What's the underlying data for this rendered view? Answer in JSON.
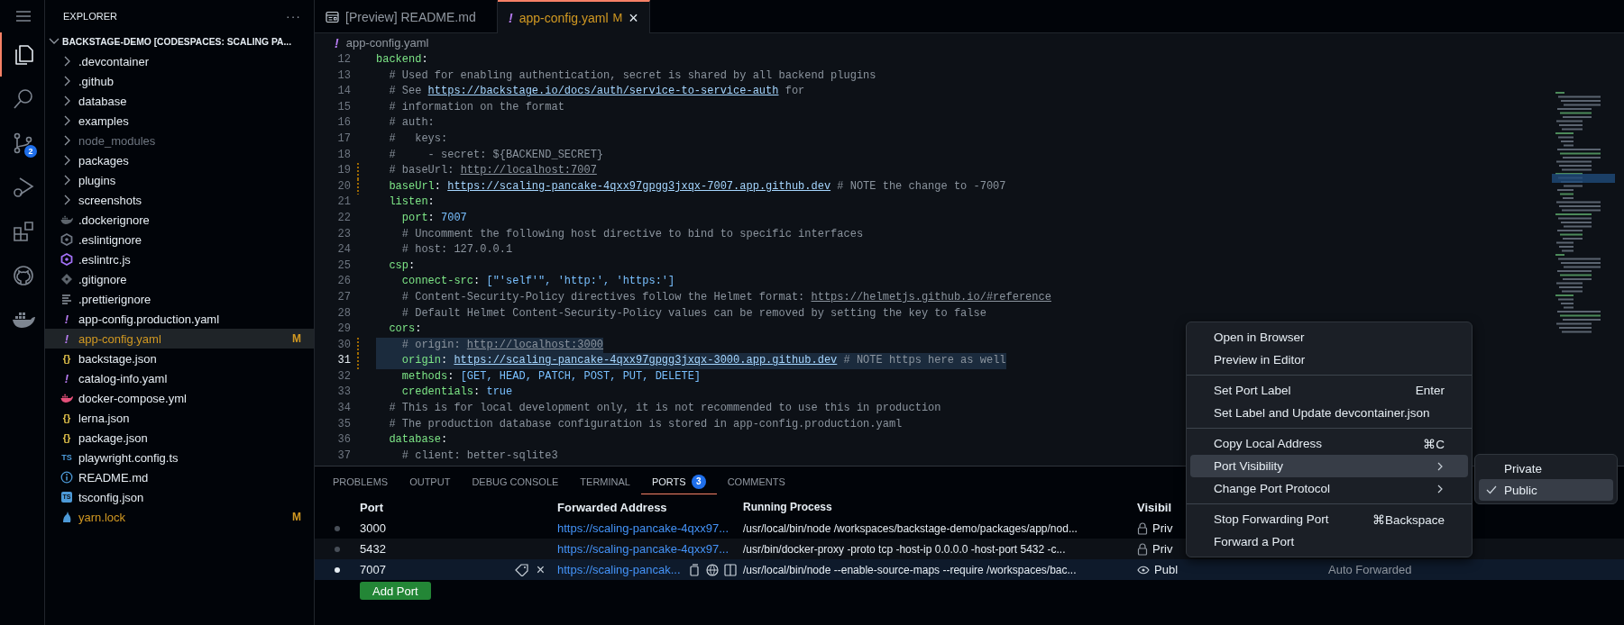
{
  "activity_bar": [
    {
      "kind": "menu",
      "selected": false
    },
    {
      "kind": "files",
      "selected": true
    },
    {
      "kind": "search",
      "selected": false
    },
    {
      "kind": "source-control",
      "badge": "2",
      "selected": false
    },
    {
      "kind": "run-debug",
      "selected": false
    },
    {
      "kind": "extensions",
      "selected": false
    },
    {
      "kind": "github",
      "selected": false
    },
    {
      "kind": "docker",
      "selected": false
    }
  ],
  "explorer": {
    "title": "EXPLORER",
    "more": "···",
    "root": {
      "name": "BACKSTAGE-DEMO [CODESPACES: SCALING PA...",
      "expanded": true
    },
    "items": [
      {
        "name": ".devcontainer",
        "kind": "folder",
        "expanded": false,
        "selected": false
      },
      {
        "name": ".github",
        "kind": "folder",
        "expanded": false,
        "selected": false
      },
      {
        "name": "database",
        "kind": "folder",
        "expanded": false,
        "selected": false
      },
      {
        "name": "examples",
        "kind": "folder",
        "expanded": false,
        "selected": false
      },
      {
        "name": "node_modules",
        "kind": "folder",
        "expanded": false,
        "dimmed": true,
        "selected": false
      },
      {
        "name": "packages",
        "kind": "folder",
        "expanded": false,
        "selected": false
      },
      {
        "name": "plugins",
        "kind": "folder",
        "expanded": false,
        "selected": false
      },
      {
        "name": "screenshots",
        "kind": "folder",
        "expanded": false,
        "selected": false
      },
      {
        "name": ".dockerignore",
        "kind": "docker-dim",
        "selected": false
      },
      {
        "name": ".eslintignore",
        "kind": "eslint-dim",
        "selected": false
      },
      {
        "name": ".eslintrc.js",
        "kind": "eslint",
        "selected": false
      },
      {
        "name": ".gitignore",
        "kind": "git",
        "selected": false
      },
      {
        "name": ".prettierignore",
        "kind": "lines",
        "selected": false
      },
      {
        "name": "app-config.production.yaml",
        "kind": "yaml",
        "glyph": "!",
        "selected": false
      },
      {
        "name": "app-config.yaml",
        "kind": "yaml",
        "glyph": "!",
        "status": "M",
        "selected": true
      },
      {
        "name": "backstage.json",
        "kind": "json",
        "glyph": "{}",
        "selected": false
      },
      {
        "name": "catalog-info.yaml",
        "kind": "yaml",
        "glyph": "!",
        "selected": false
      },
      {
        "name": "docker-compose.yml",
        "kind": "docker",
        "selected": false
      },
      {
        "name": "lerna.json",
        "kind": "json",
        "glyph": "{}",
        "selected": false
      },
      {
        "name": "package.json",
        "kind": "json",
        "glyph": "{}",
        "selected": false
      },
      {
        "name": "playwright.config.ts",
        "kind": "ts",
        "glyph": "TS",
        "selected": false
      },
      {
        "name": "README.md",
        "kind": "info",
        "selected": false
      },
      {
        "name": "tsconfig.json",
        "kind": "tsconfig",
        "glyph": "TS",
        "selected": false
      },
      {
        "name": "yarn.lock",
        "kind": "yarn",
        "status": "M",
        "selected": false
      }
    ]
  },
  "tabs": [
    {
      "label": "[Preview] README.md",
      "kind": "preview",
      "selected": false
    },
    {
      "label": "app-config.yaml",
      "kind": "yaml",
      "glyph": "!",
      "status": "M",
      "close": "×",
      "selected": true
    }
  ],
  "breadcrumb": {
    "glyph": "!",
    "label": "app-config.yaml"
  },
  "code_lines": [
    {
      "number": "12",
      "tokens": [
        {
          "kind": "key",
          "text": "backend"
        },
        {
          "kind": "punct",
          "text": ":"
        }
      ]
    },
    {
      "number": "13",
      "tokens": [
        {
          "kind": "comment",
          "text": "  # Used for enabling authentication, secret is shared by all backend plugins"
        }
      ]
    },
    {
      "number": "14",
      "tokens": [
        {
          "kind": "comment",
          "text": "  # See "
        },
        {
          "kind": "link",
          "text": "https://backstage.io/docs/auth/service-to-service-auth"
        },
        {
          "kind": "comment",
          "text": " for"
        }
      ]
    },
    {
      "number": "15",
      "tokens": [
        {
          "kind": "comment",
          "text": "  # information on the format"
        }
      ]
    },
    {
      "number": "16",
      "tokens": [
        {
          "kind": "comment",
          "text": "  # auth:"
        }
      ]
    },
    {
      "number": "17",
      "tokens": [
        {
          "kind": "comment",
          "text": "  #   keys:"
        }
      ]
    },
    {
      "number": "18",
      "tokens": [
        {
          "kind": "comment",
          "text": "  #     - secret: ${BACKEND_SECRET}"
        }
      ]
    },
    {
      "number": "19",
      "modified": true,
      "tokens": [
        {
          "kind": "comment",
          "text": "  # baseUrl: "
        },
        {
          "kind": "clink",
          "text": "http://localhost:7007"
        }
      ]
    },
    {
      "number": "20",
      "modified": true,
      "tokens": [
        {
          "kind": "key",
          "text": "  baseUrl"
        },
        {
          "kind": "punct",
          "text": ": "
        },
        {
          "kind": "link",
          "text": "https://scaling-pancake-4qxx97gpgg3jxqx-7007.app.github.dev"
        },
        {
          "kind": "comment",
          "text": " # NOTE the change to -7007"
        }
      ]
    },
    {
      "number": "21",
      "tokens": [
        {
          "kind": "key",
          "text": "  listen"
        },
        {
          "kind": "punct",
          "text": ":"
        }
      ]
    },
    {
      "number": "22",
      "tokens": [
        {
          "kind": "key",
          "text": "    port"
        },
        {
          "kind": "punct",
          "text": ": "
        },
        {
          "kind": "value",
          "text": "7007"
        }
      ]
    },
    {
      "number": "23",
      "tokens": [
        {
          "kind": "comment",
          "text": "    # Uncomment the following host directive to bind to specific interfaces"
        }
      ]
    },
    {
      "number": "24",
      "tokens": [
        {
          "kind": "comment",
          "text": "    # host: 127.0.0.1"
        }
      ]
    },
    {
      "number": "25",
      "tokens": [
        {
          "kind": "key",
          "text": "  csp"
        },
        {
          "kind": "punct",
          "text": ":"
        }
      ]
    },
    {
      "number": "26",
      "tokens": [
        {
          "kind": "key",
          "text": "    connect-src"
        },
        {
          "kind": "punct",
          "text": ": "
        },
        {
          "kind": "value",
          "text": "[\"'self'\", 'http:', 'https:']"
        }
      ]
    },
    {
      "number": "27",
      "tokens": [
        {
          "kind": "comment",
          "text": "    # Content-Security-Policy directives follow the Helmet format: "
        },
        {
          "kind": "clink",
          "text": "https://helmetjs.github.io/#reference"
        }
      ]
    },
    {
      "number": "28",
      "tokens": [
        {
          "kind": "comment",
          "text": "    # Default Helmet Content-Security-Policy values can be removed by setting the key to false"
        }
      ]
    },
    {
      "number": "29",
      "tokens": [
        {
          "kind": "key",
          "text": "  cors"
        },
        {
          "kind": "punct",
          "text": ":"
        }
      ]
    },
    {
      "number": "30",
      "modified": true,
      "selected": true,
      "tokens": [
        {
          "kind": "comment",
          "text": "    # origin: "
        },
        {
          "kind": "clink",
          "text": "http://localhost:3000"
        }
      ]
    },
    {
      "number": "31",
      "modified": true,
      "selected": true,
      "current": true,
      "tokens": [
        {
          "kind": "key",
          "text": "    origin"
        },
        {
          "kind": "punct",
          "text": ": "
        },
        {
          "kind": "link",
          "text": "https://scaling-pancake-4qxx97gpgg3jxqx-3000.app.github.dev"
        },
        {
          "kind": "comment",
          "text": " # NOTE https here as well"
        }
      ]
    },
    {
      "number": "32",
      "tokens": [
        {
          "kind": "key",
          "text": "    methods"
        },
        {
          "kind": "punct",
          "text": ": "
        },
        {
          "kind": "value",
          "text": "[GET, HEAD, PATCH, POST, PUT, DELETE]"
        }
      ]
    },
    {
      "number": "33",
      "tokens": [
        {
          "kind": "key",
          "text": "    credentials"
        },
        {
          "kind": "punct",
          "text": ": "
        },
        {
          "kind": "value",
          "text": "true"
        }
      ]
    },
    {
      "number": "34",
      "tokens": [
        {
          "kind": "comment",
          "text": "  # This is for local development only, it is not recommended to use this in production"
        }
      ]
    },
    {
      "number": "35",
      "tokens": [
        {
          "kind": "comment",
          "text": "  # The production database configuration is stored in app-config.production.yaml"
        }
      ]
    },
    {
      "number": "36",
      "tokens": [
        {
          "kind": "key",
          "text": "  database"
        },
        {
          "kind": "punct",
          "text": ":"
        }
      ]
    },
    {
      "number": "37",
      "tokens": [
        {
          "kind": "comment",
          "text": "    # client: better-sqlite3"
        }
      ]
    }
  ],
  "panel": {
    "tabs": [
      {
        "label": "PROBLEMS",
        "selected": false
      },
      {
        "label": "OUTPUT",
        "selected": false
      },
      {
        "label": "DEBUG CONSOLE",
        "selected": false
      },
      {
        "label": "TERMINAL",
        "selected": false
      },
      {
        "label": "PORTS",
        "badge": "3",
        "selected": true
      },
      {
        "label": "COMMENTS",
        "selected": false
      }
    ],
    "columns": [
      "Port",
      "Forwarded Address",
      "Running Process",
      "Visibil"
    ],
    "rows": [
      {
        "port": "3000",
        "address": "https://scaling-pancake-4qxx97...",
        "process": "/usr/local/bin/node /workspaces/backstage-demo/packages/app/nod...",
        "kind": "private",
        "visibility_label": "Priv",
        "active": false,
        "hovered": false,
        "selected": false
      },
      {
        "port": "5432",
        "address": "https://scaling-pancake-4qxx97...",
        "process": "/usr/bin/docker-proxy -proto tcp -host-ip 0.0.0.0 -host-port 5432 -c...",
        "kind": "private",
        "visibility_label": "Priv",
        "active": false,
        "hovered": true,
        "selected": false
      },
      {
        "port": "7007",
        "address": "https://scaling-pancak...",
        "process": "/usr/local/bin/node --enable-source-maps --require /workspaces/bac...",
        "kind": "public",
        "visibility_label": "Publ",
        "origin": "Auto Forwarded",
        "active": true,
        "hovered": false,
        "selected": true,
        "close": "×"
      }
    ],
    "add_button": "Add Port"
  },
  "context_menu": {
    "groups": [
      [
        {
          "label": "Open in Browser",
          "selected": false
        },
        {
          "label": "Preview in Editor",
          "selected": false
        }
      ],
      [
        {
          "label": "Set Port Label",
          "shortcut": "Enter",
          "selected": false
        },
        {
          "label": "Set Label and Update devcontainer.json",
          "selected": false
        }
      ],
      [
        {
          "label": "Copy Local Address",
          "shortcut": "⌘C",
          "selected": false
        },
        {
          "label": "Port Visibility",
          "submenu": true,
          "selected": true
        },
        {
          "label": "Change Port Protocol",
          "submenu": true,
          "selected": false
        }
      ],
      [
        {
          "label": "Stop Forwarding Port",
          "shortcut": "⌘Backspace",
          "selected": false
        },
        {
          "label": "Forward a Port",
          "selected": false
        }
      ]
    ],
    "submenu": [
      {
        "label": "Private",
        "checked": false,
        "selected": false
      },
      {
        "label": "Public",
        "checked": true,
        "selected": true
      }
    ]
  }
}
